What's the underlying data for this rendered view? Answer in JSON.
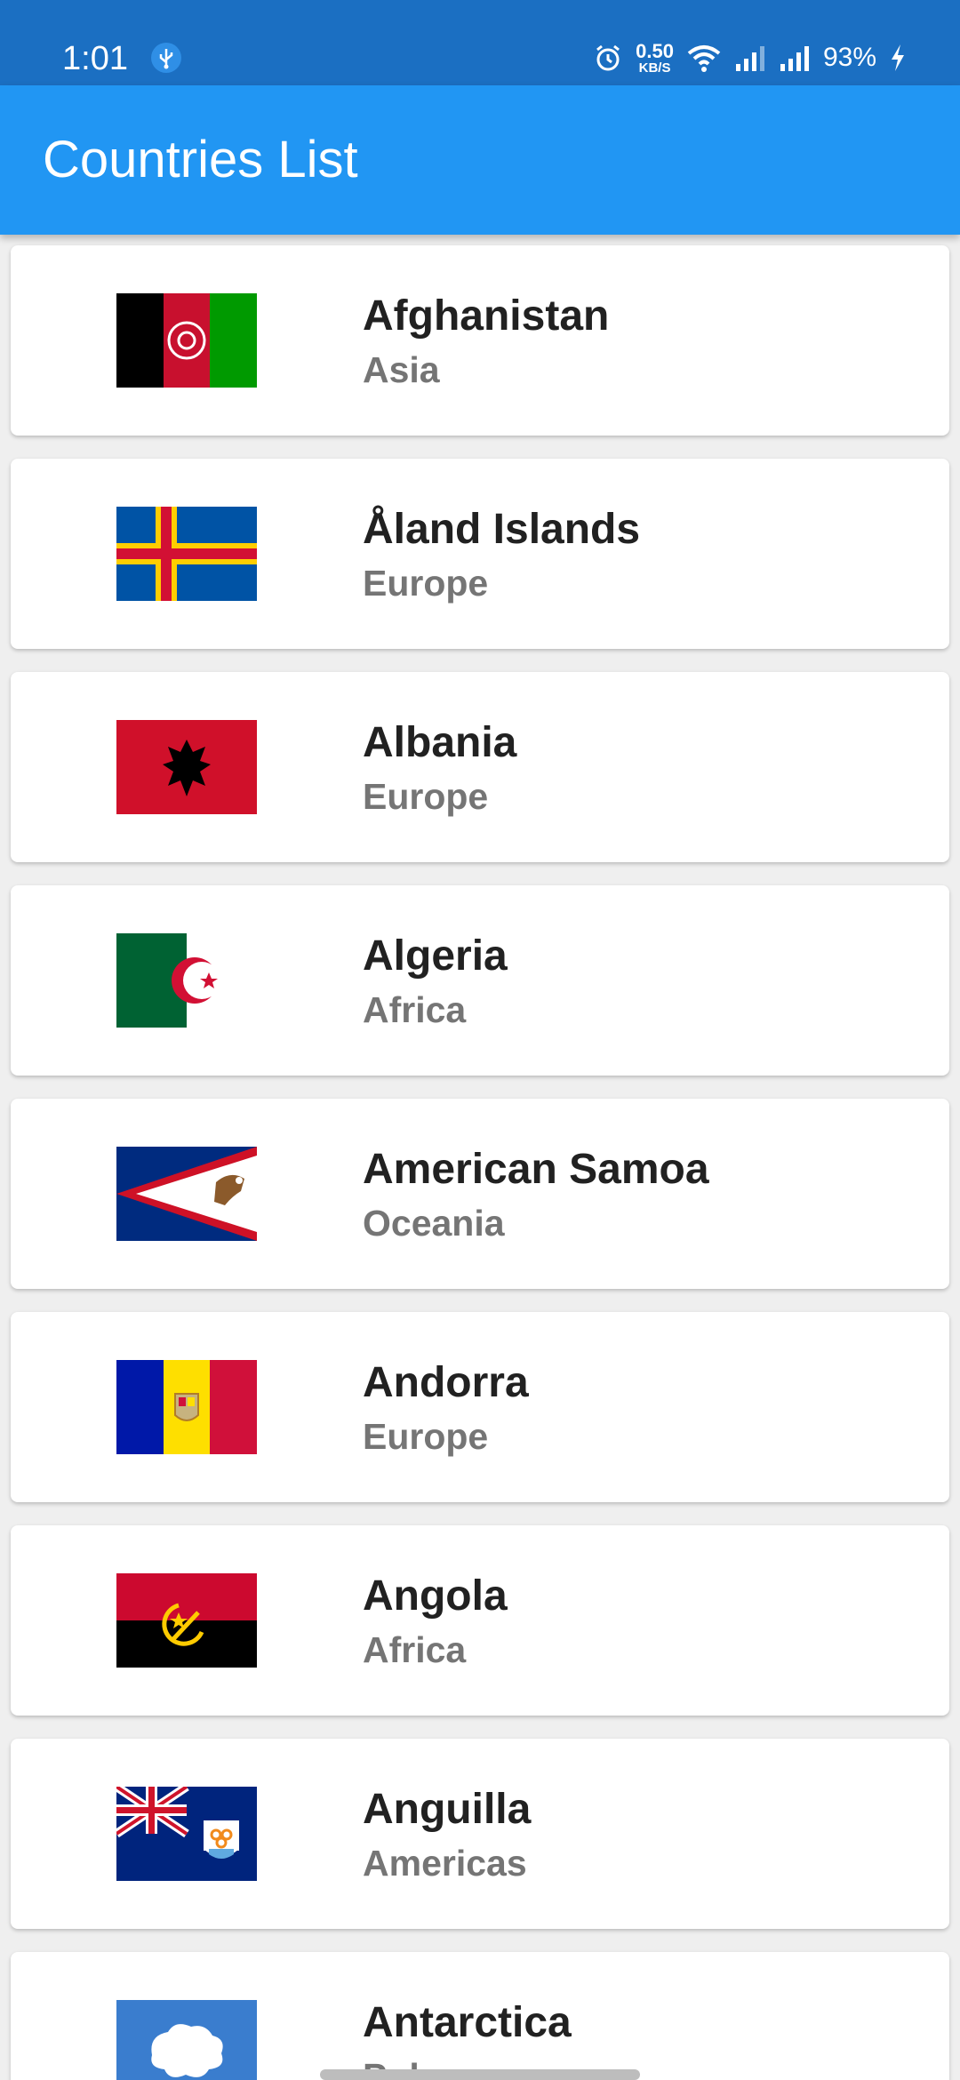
{
  "status_bar": {
    "time": "1:01",
    "speed_value": "0.50",
    "speed_unit": "KB/S",
    "battery": "93%"
  },
  "app_bar": {
    "title": "Countries List"
  },
  "countries": [
    {
      "name": "Afghanistan",
      "region": "Asia",
      "flag_icon": "afghanistan-flag-icon"
    },
    {
      "name": "Åland Islands",
      "region": "Europe",
      "flag_icon": "aland-islands-flag-icon"
    },
    {
      "name": "Albania",
      "region": "Europe",
      "flag_icon": "albania-flag-icon"
    },
    {
      "name": "Algeria",
      "region": "Africa",
      "flag_icon": "algeria-flag-icon"
    },
    {
      "name": "American Samoa",
      "region": "Oceania",
      "flag_icon": "american-samoa-flag-icon"
    },
    {
      "name": "Andorra",
      "region": "Europe",
      "flag_icon": "andorra-flag-icon"
    },
    {
      "name": "Angola",
      "region": "Africa",
      "flag_icon": "angola-flag-icon"
    },
    {
      "name": "Anguilla",
      "region": "Americas",
      "flag_icon": "anguilla-flag-icon"
    },
    {
      "name": "Antarctica",
      "region": "Polar",
      "flag_icon": "antarctica-flag-icon"
    }
  ],
  "colors": {
    "status_bar": "#1b6fc2",
    "app_bar": "#2196f3",
    "name_text": "#212121",
    "region_text": "#757575"
  }
}
